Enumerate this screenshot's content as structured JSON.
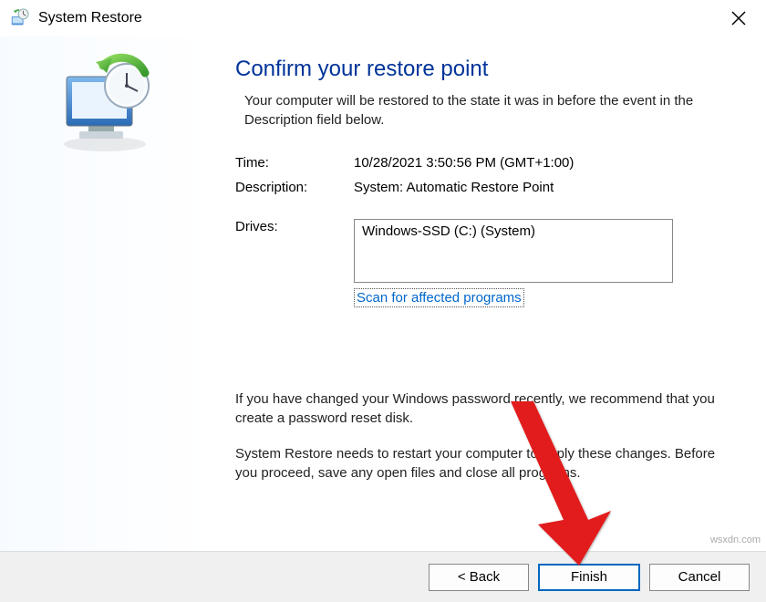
{
  "window": {
    "title": "System Restore"
  },
  "page": {
    "heading": "Confirm your restore point",
    "subhead": "Your computer will be restored to the state it was in before the event in the Description field below.",
    "time_label": "Time:",
    "time_value": "10/28/2021 3:50:56 PM (GMT+1:00)",
    "desc_label": "Description:",
    "desc_value": "System: Automatic Restore Point",
    "drives_label": "Drives:",
    "drives_value": "Windows-SSD (C:) (System)",
    "scan_link": "Scan for affected programs",
    "note1": "If you have changed your Windows password recently, we recommend that you create a password reset disk.",
    "note2": "System Restore needs to restart your computer to apply these changes. Before you proceed, save any open files and close all programs."
  },
  "buttons": {
    "back": "< Back",
    "finish": "Finish",
    "cancel": "Cancel"
  },
  "watermark": "wsxdn.com"
}
